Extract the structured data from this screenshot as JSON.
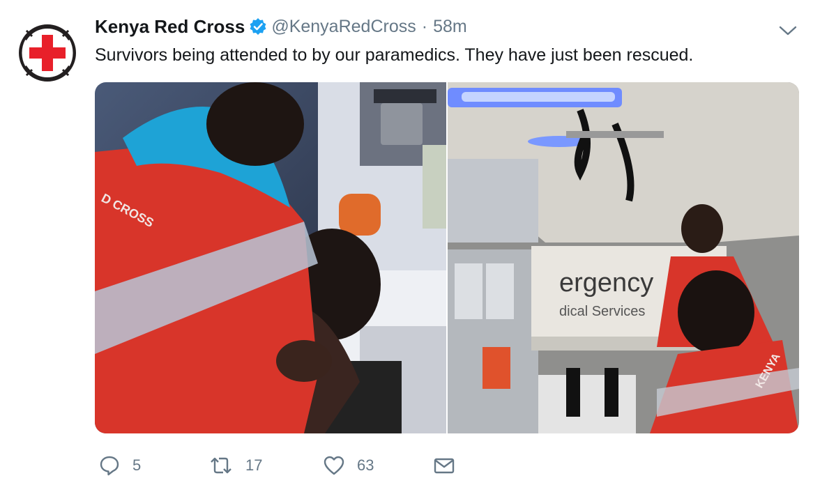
{
  "tweet": {
    "author_name": "Kenya Red Cross",
    "handle": "@KenyaRedCross",
    "separator": "·",
    "time": "58m",
    "text": "Survivors being attended to by our paramedics. They have just been rescued.",
    "verified": true
  },
  "photos": {
    "left": {
      "vest_text": "D CROSS"
    },
    "right": {
      "window_text_1": "ergency",
      "window_text_2": "dical Services",
      "vest_text": "KENYA"
    }
  },
  "actions": {
    "reply_count": "5",
    "retweet_count": "17",
    "like_count": "63"
  },
  "colors": {
    "text_primary": "#14171a",
    "text_secondary": "#657786",
    "verified_blue": "#1da1f2",
    "red_cross": "#e8202a"
  }
}
